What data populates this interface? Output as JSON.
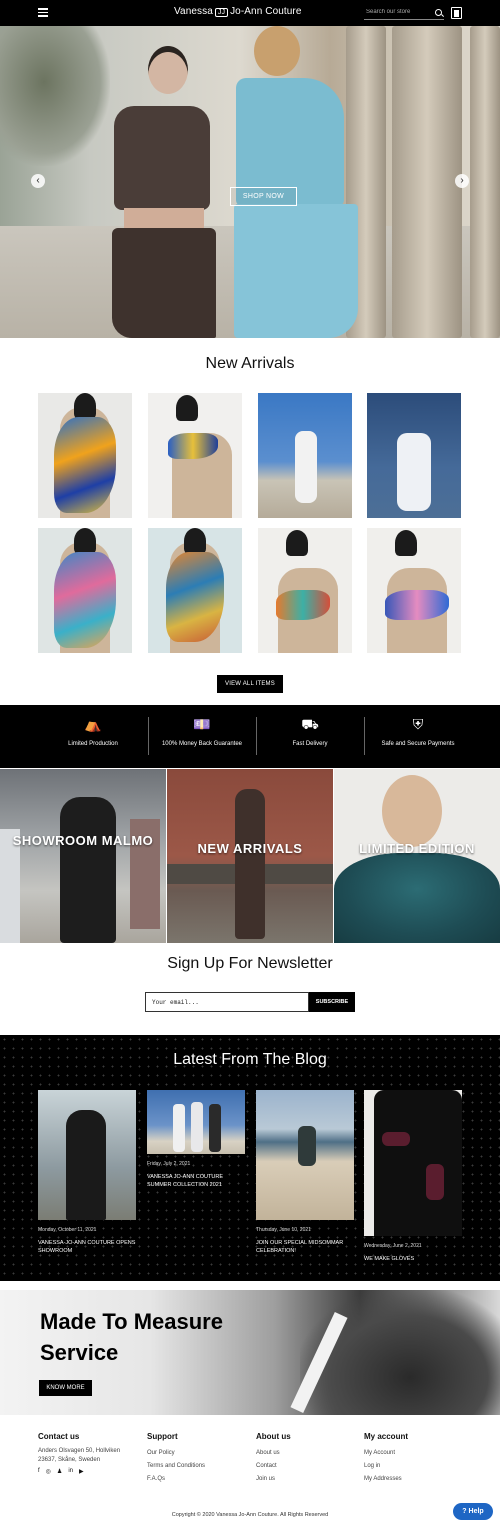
{
  "header": {
    "brand_left": "Vanessa",
    "brand_mark": "JJ",
    "brand_right": "Jo-Ann Couture",
    "search_placeholder": "Search our store"
  },
  "hero": {
    "cta": "SHOP NOW",
    "prev": "‹",
    "next": "›"
  },
  "new_arrivals": {
    "title": "New Arrivals",
    "view_all": "VIEW ALL ITEMS"
  },
  "features": [
    {
      "icon": "tent-icon",
      "glyph": "⛺",
      "label": "Limited Production"
    },
    {
      "icon": "money-icon",
      "glyph": "💷",
      "label": "100% Money Back Guarantee"
    },
    {
      "icon": "truck-icon",
      "glyph": "⛟",
      "label": "Fast Delivery"
    },
    {
      "icon": "shield-icon",
      "glyph": "⛨",
      "label": "Safe and Secure Payments"
    }
  ],
  "tiles": {
    "showroom": "SHOWROOM MALMO",
    "new_arrivals": "NEW ARRIVALS",
    "limited": "LIMITED EDITION"
  },
  "newsletter": {
    "title": "Sign Up For Newsletter",
    "placeholder": "Your email...",
    "button": "SUBSCRIBE"
  },
  "blog": {
    "title": "Latest From The Blog",
    "posts": [
      {
        "date": "Monday, October 11, 2021",
        "title": "VANESSA-JO-ANN COUTURE OPENS SHOWROOM"
      },
      {
        "date": "Friday, July 2, 2021",
        "title": "VANESSA JO-ANN COUTURE SUMMER COLLECTION 2021"
      },
      {
        "date": "Thursday, June 10, 2021",
        "title": "JOIN OUR SPECIAL MIDSOMMAR CELEBRATION!"
      },
      {
        "date": "Wednesday, June 2, 2021",
        "title": "WE MAKE GLOVES"
      }
    ]
  },
  "mtm": {
    "title": "Made To Measure Service",
    "button": "KNOW MORE"
  },
  "footer": {
    "contact": {
      "heading": "Contact us",
      "address": "Anders Olsvagen 50, Hollviken 23637, Skåne, Sweden"
    },
    "support": {
      "heading": "Support",
      "items": [
        "Our Policy",
        "Terms and Conditions",
        "F.A.Qs"
      ]
    },
    "about": {
      "heading": "About us",
      "items": [
        "About us",
        "Contact",
        "Join us"
      ]
    },
    "account": {
      "heading": "My account",
      "items": [
        "My Account",
        "Log in",
        "My Addresses"
      ]
    },
    "socials": [
      "f",
      "◎",
      "♟",
      "in",
      "▶"
    ],
    "copyright": "Copyright © 2020 Vanessa Jo-Ann Couture. All Rights Reserved",
    "help": "? Help"
  },
  "colors": {
    "black": "#000000",
    "help_blue": "#1e66c4"
  }
}
